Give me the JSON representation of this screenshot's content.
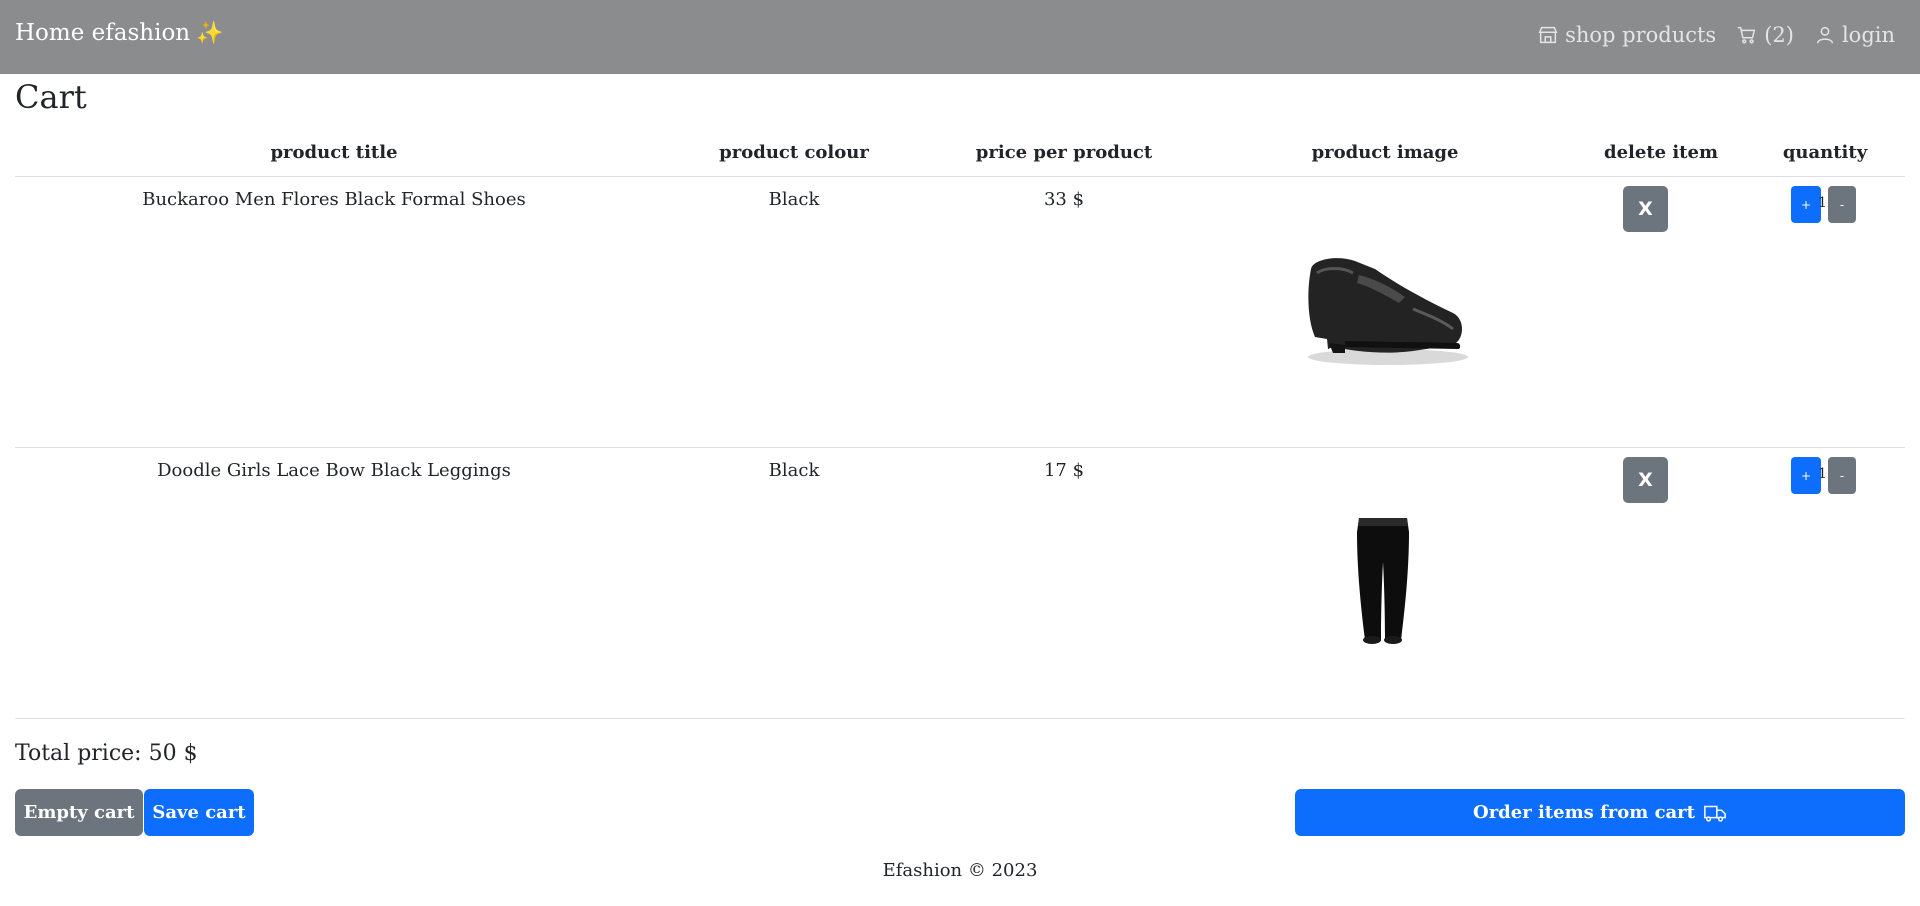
{
  "nav": {
    "brand": "Home efashion",
    "brand_icon": "sparkles-icon",
    "shop_label": "shop products",
    "cart_label": "(2)",
    "login_label": "login"
  },
  "page": {
    "title": "Cart"
  },
  "table": {
    "headers": [
      "product title",
      "product colour",
      "price per product",
      "product image",
      "delete item",
      "quantity"
    ],
    "rows": [
      {
        "title": "Buckaroo Men Flores Black Formal Shoes",
        "colour": "Black",
        "price": "33 $",
        "image_icon": "black-formal-shoe-image",
        "delete_label": "X",
        "plus_label": "+",
        "quantity": "1",
        "minus_label": "-"
      },
      {
        "title": "Doodle Girls Lace Bow Black Leggings",
        "colour": "Black",
        "price": "17 $",
        "image_icon": "black-leggings-image",
        "delete_label": "X",
        "plus_label": "+",
        "quantity": "1",
        "minus_label": "-"
      }
    ]
  },
  "summary": {
    "total": "Total price: 50 $"
  },
  "actions": {
    "empty_label": "Empty cart",
    "save_label": "Save cart",
    "order_label": "Order items from cart",
    "order_icon": "truck-icon"
  },
  "footer": {
    "text": "Efashion © 2023"
  },
  "colors": {
    "navbar": "#8b8c8e",
    "primary": "#0d6efd",
    "secondary": "#6c757d"
  }
}
